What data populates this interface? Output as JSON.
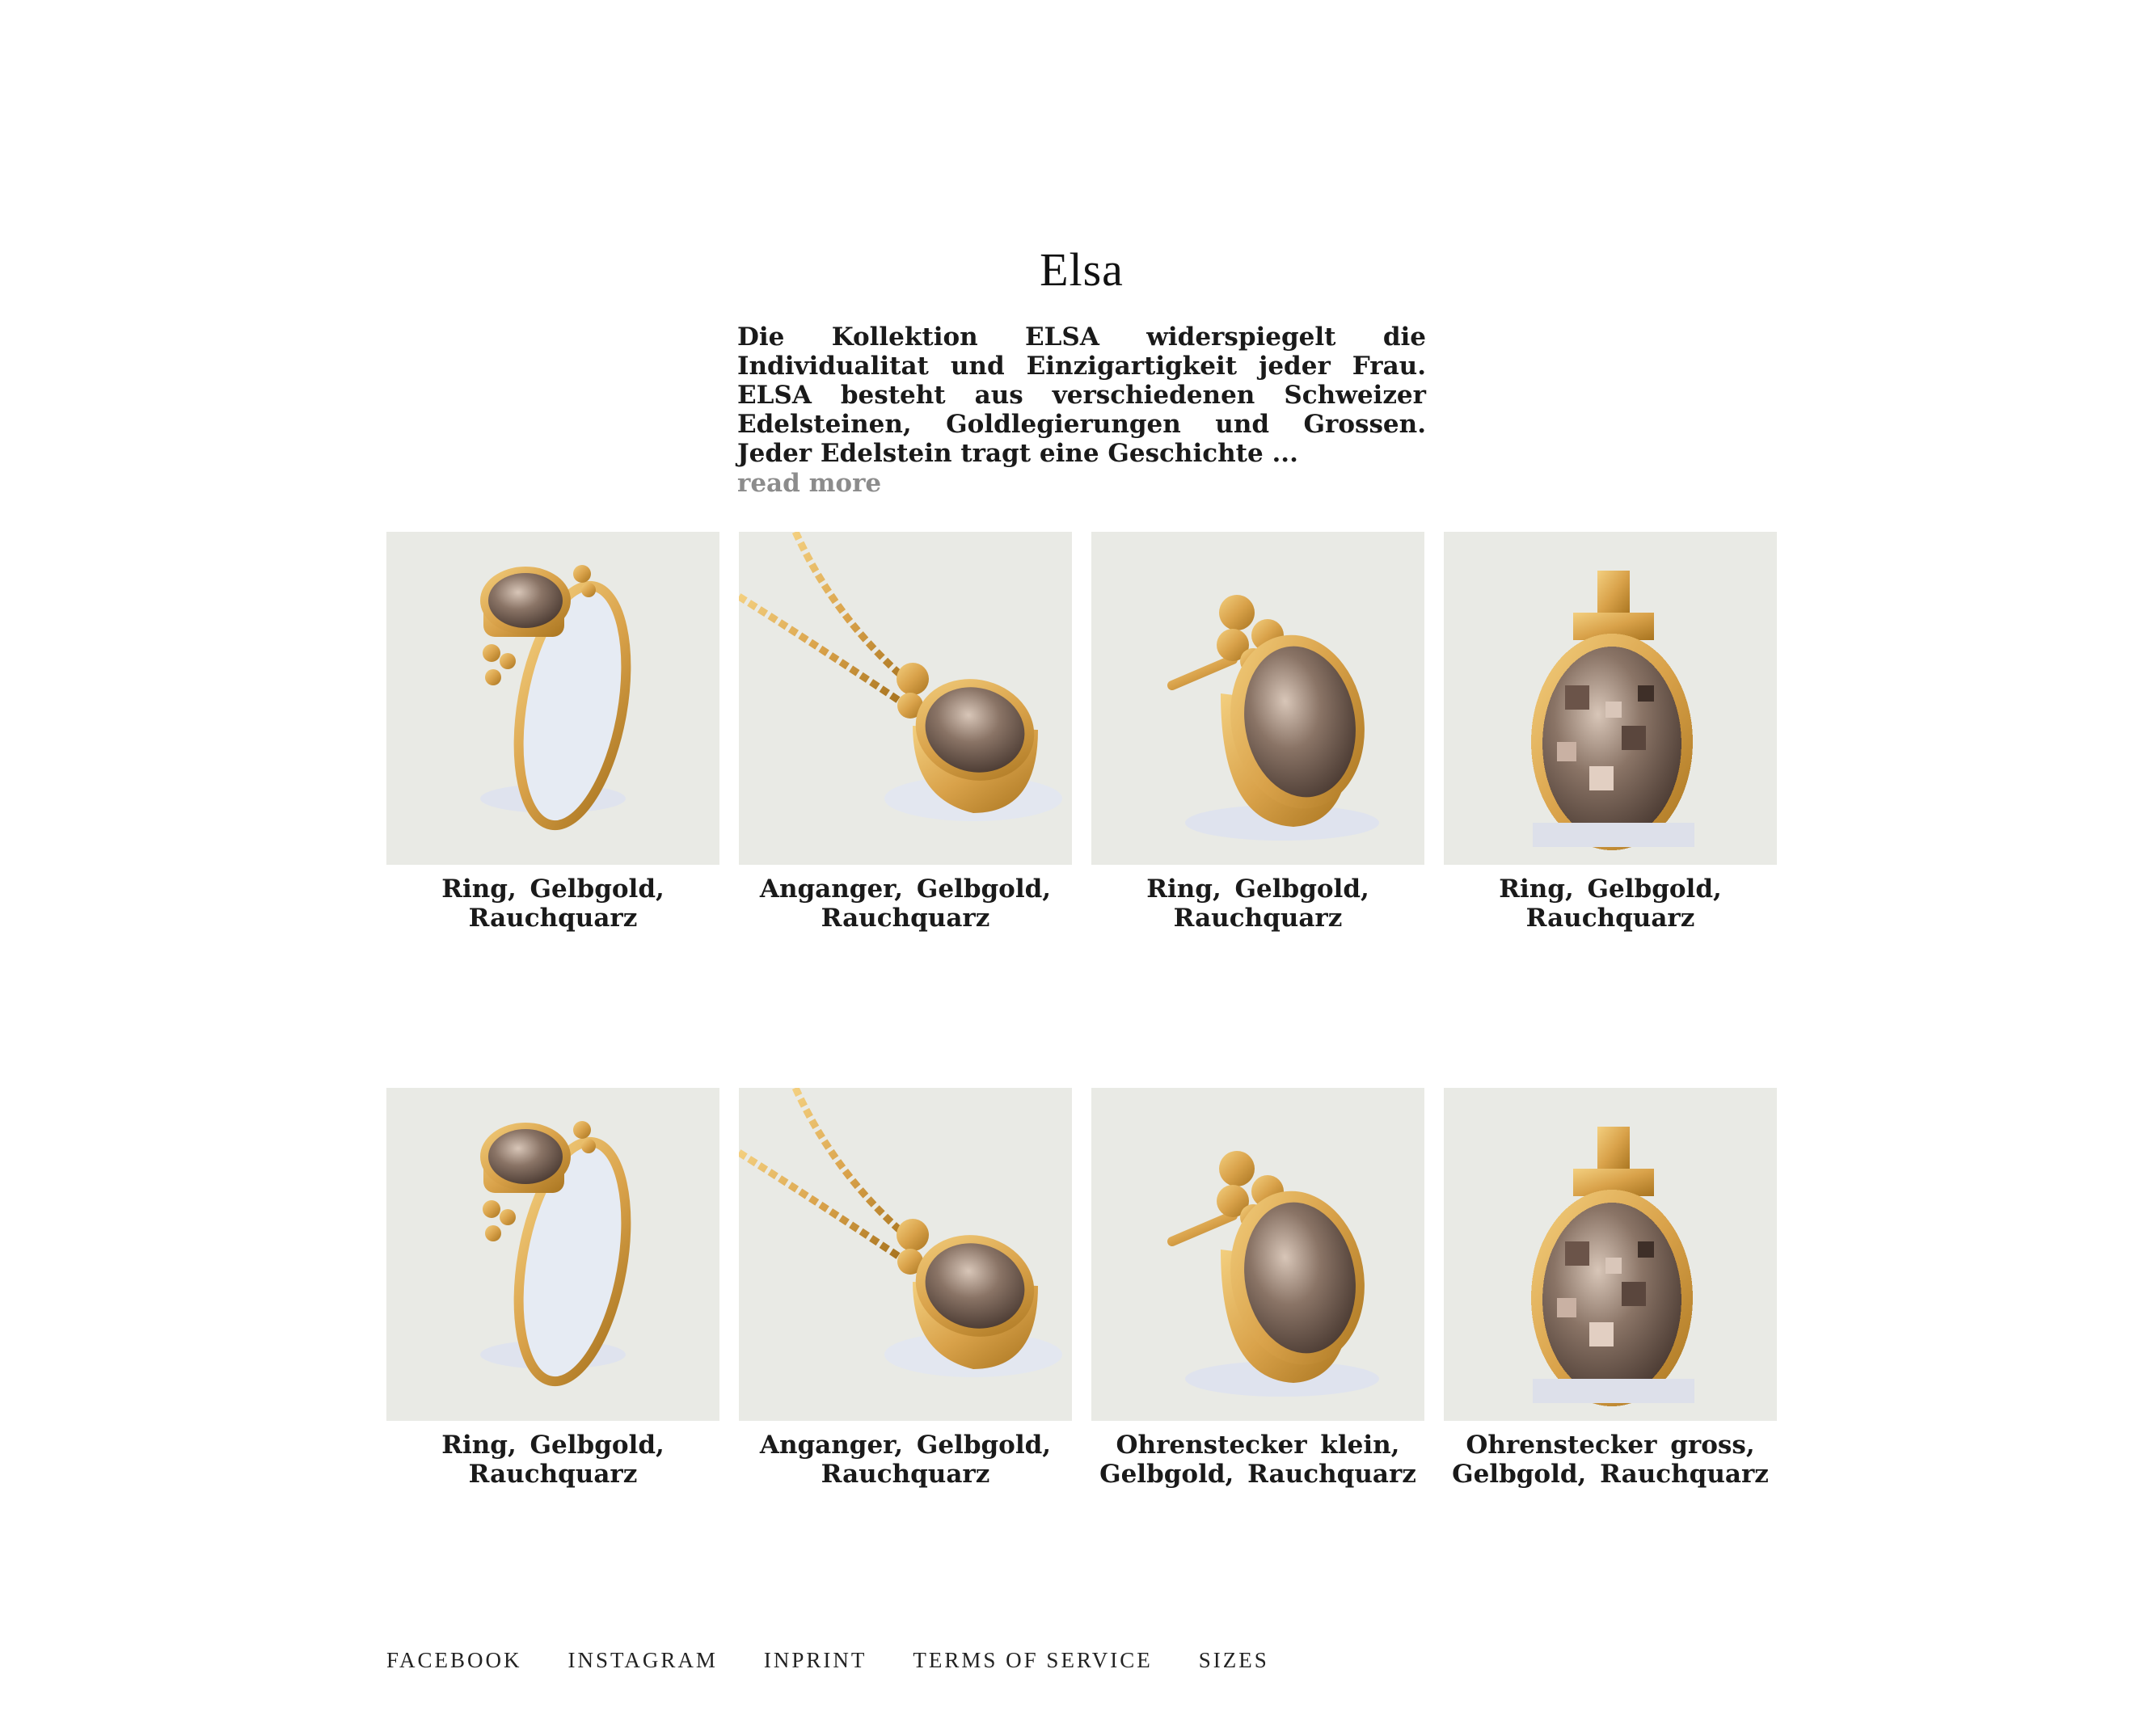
{
  "collection": {
    "title": "Elsa",
    "description": "Die Kollektion ELSA widerspiegelt die Individualitat und Einzigartigkeit jeder Frau. ELSA besteht aus verschiedenen Schweizer Edelsteinen, Goldlegierungen und Grossen. Jeder Edelstein tragt eine Geschichte ...",
    "read_more": "read more"
  },
  "products": [
    {
      "kind": "ring",
      "caption": "Ring, Gelbgold, Rauchquarz"
    },
    {
      "kind": "pendant",
      "caption": "Anganger, Gelbgold, Rauchquarz"
    },
    {
      "kind": "stud",
      "caption": "Ring, Gelbgold, Rauchquarz"
    },
    {
      "kind": "pixelated",
      "caption": "Ring, Gelbgold, Rauchquarz"
    },
    {
      "kind": "ring",
      "caption": "Ring, Gelbgold, Rauchquarz"
    },
    {
      "kind": "pendant",
      "caption": "Anganger, Gelbgold, Rauchquarz"
    },
    {
      "kind": "stud",
      "caption": "Ohrenstecker klein, Gelbgold, Rauchquarz"
    },
    {
      "kind": "pixelated",
      "caption": "Ohrenstecker gross, Gelbgold, Rauchquarz"
    }
  ],
  "footer": {
    "links": [
      "FACEBOOK",
      "INSTAGRAM",
      "INPRINT",
      "TERMS OF SERVICE",
      "SIZES"
    ]
  },
  "colors": {
    "tile_background": "#e9eae5",
    "gold": "#d9a24a",
    "smoky_quartz": "#8a7466",
    "read_more": "#8c8c8c"
  }
}
